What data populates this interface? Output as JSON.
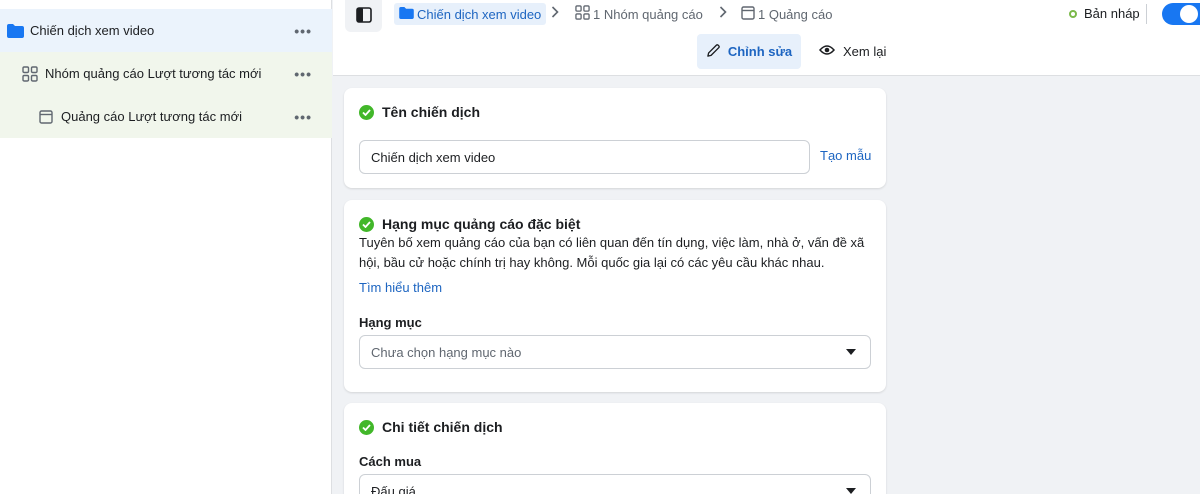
{
  "sidebar": {
    "campaign": {
      "label": "Chiến dịch xem video",
      "more": "•••"
    },
    "adset": {
      "label": "Nhóm quảng cáo Lượt tương tác mới",
      "more": "•••"
    },
    "ad": {
      "label": "Quảng cáo Lượt tương tác mới",
      "more": "•••"
    }
  },
  "header": {
    "breadcrumbs": [
      {
        "label": "Chiến dịch xem video",
        "icon": "folder-icon"
      },
      {
        "label": "1 Nhóm quảng cáo",
        "icon": "grid-icon"
      },
      {
        "label": "1 Quảng cáo",
        "icon": "ad-icon"
      }
    ],
    "status": "Bản nháp",
    "tabs": {
      "edit": "Chỉnh sửa",
      "review": "Xem lại"
    }
  },
  "name_card": {
    "title": "Tên chiến dịch",
    "value": "Chiến dịch xem video",
    "template_link": "Tạo mẫu"
  },
  "special_card": {
    "title": "Hạng mục quảng cáo đặc biệt",
    "description": "Tuyên bố xem quảng cáo của bạn có liên quan đến tín dụng, việc làm, nhà ở, vấn đề xã hội, bầu cử hoặc chính trị hay không. Mỗi quốc gia lại có các yêu cầu khác nhau.",
    "learn_more": "Tìm hiểu thêm",
    "category_label": "Hạng mục",
    "category_placeholder": "Chưa chọn hạng mục nào"
  },
  "details_card": {
    "title": "Chi tiết chiến dịch",
    "buying_label": "Cách mua",
    "buying_value": "Đấu giá"
  },
  "colors": {
    "accent": "#1877f2",
    "link": "#1d65c1",
    "success": "#42b72a",
    "selected_bg": "#ebf3fc",
    "child_bg": "#f1f6ec"
  }
}
